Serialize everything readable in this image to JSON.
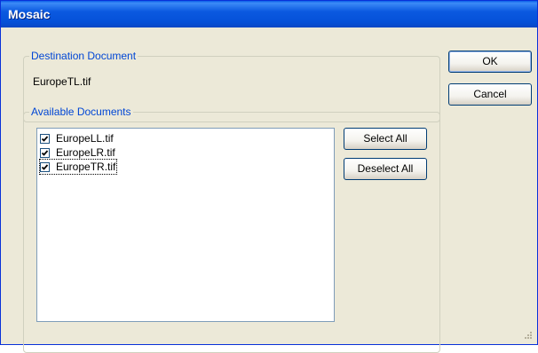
{
  "window": {
    "title": "Mosaic"
  },
  "destination": {
    "legend": "Destination Document",
    "value": "EuropeTL.tif"
  },
  "available": {
    "legend": "Available Documents",
    "items": [
      {
        "label": "EuropeLL.tif",
        "checked": true
      },
      {
        "label": "EuropeLR.tif",
        "checked": true
      },
      {
        "label": "EuropeTR.tif",
        "checked": true
      }
    ]
  },
  "buttons": {
    "ok": "OK",
    "cancel": "Cancel",
    "select_all": "Select All",
    "deselect_all": "Deselect All"
  },
  "colors": {
    "titlebar": "#0551d8",
    "legend_text": "#0046d5",
    "dialog_bg": "#ece9d8"
  }
}
